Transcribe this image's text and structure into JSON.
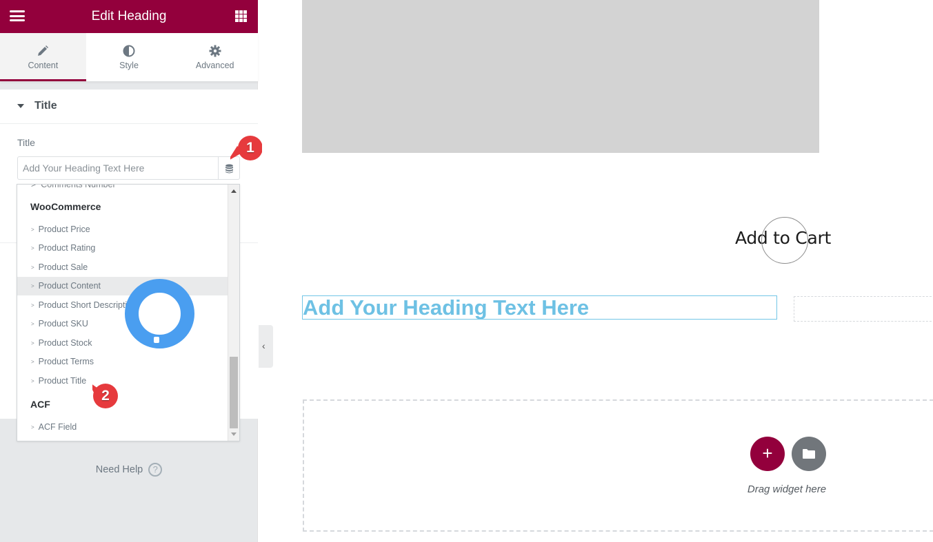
{
  "panel": {
    "header": {
      "title": "Edit Heading",
      "menu_icon": "hamburger-icon",
      "widgets_icon": "grid-icon"
    },
    "tabs": [
      {
        "label": "Content",
        "icon": "pencil-icon",
        "active": true
      },
      {
        "label": "Style",
        "icon": "half-circle-icon",
        "active": false
      },
      {
        "label": "Advanced",
        "icon": "gear-icon",
        "active": false
      }
    ],
    "section": {
      "title": "Title"
    },
    "control": {
      "label": "Title",
      "input_value": "",
      "input_placeholder": "Add Your Heading Text Here",
      "dynamic_tags_icon": "database-icon"
    },
    "dropdown": {
      "cut_item": "Comments Number",
      "groups": [
        {
          "label": "WooCommerce",
          "items": [
            "Product Price",
            "Product Rating",
            "Product Sale",
            "Product Content",
            "Product Short Description",
            "Product SKU",
            "Product Stock",
            "Product Terms",
            "Product Title"
          ]
        },
        {
          "label": "ACF",
          "items": [
            "ACF Field"
          ]
        }
      ],
      "hovered_item": "Product Content"
    },
    "need_help": {
      "label": "Need Help",
      "icon": "question-circle-icon"
    },
    "collapse_icon": "chevron-left-icon"
  },
  "annotations": [
    {
      "number": "1",
      "color": "#e63a3d"
    },
    {
      "number": "2",
      "color": "#e63a3d"
    }
  ],
  "canvas": {
    "add_to_cart_label": "Add to Cart",
    "heading_text": "Add Your Heading Text Here",
    "drop_zone": {
      "add_icon": "plus-icon",
      "template_icon": "folder-icon",
      "label": "Drag widget here"
    }
  },
  "colors": {
    "brand": "#93003c",
    "heading": "#6ec1e4",
    "click_ring": "#4a9ef0",
    "annotation": "#e63a3d"
  }
}
